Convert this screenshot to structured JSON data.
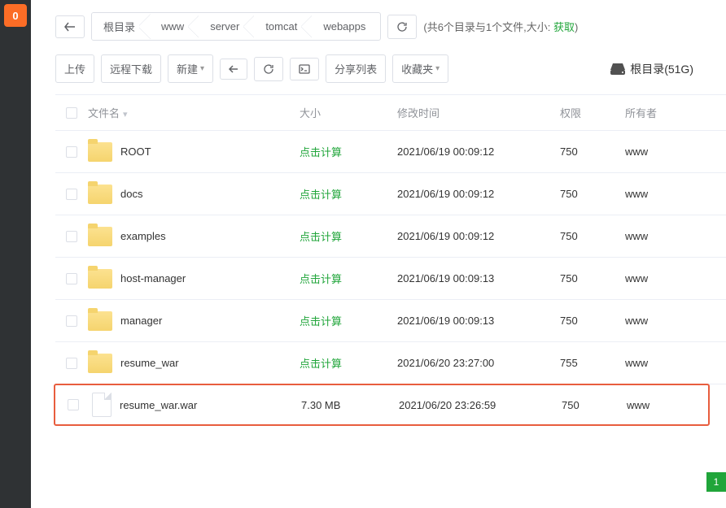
{
  "logo": "0",
  "breadcrumb": [
    "根目录",
    "www",
    "server",
    "tomcat",
    "webapps"
  ],
  "info": {
    "prefix": "(共6个目录与1个文件,大小: ",
    "link": "获取",
    "suffix": ")"
  },
  "toolbar": {
    "upload": "上传",
    "remote": "远程下载",
    "create": "新建",
    "share": "分享列表",
    "favorites": "收藏夹"
  },
  "disk": {
    "label": "根目录(51G)"
  },
  "columns": {
    "name": "文件名",
    "size": "大小",
    "time": "修改时间",
    "perm": "权限",
    "owner": "所有者"
  },
  "calc_label": "点击计算",
  "rows": [
    {
      "type": "folder",
      "name": "ROOT",
      "size": null,
      "time": "2021/06/19 00:09:12",
      "perm": "750",
      "owner": "www"
    },
    {
      "type": "folder",
      "name": "docs",
      "size": null,
      "time": "2021/06/19 00:09:12",
      "perm": "750",
      "owner": "www"
    },
    {
      "type": "folder",
      "name": "examples",
      "size": null,
      "time": "2021/06/19 00:09:12",
      "perm": "750",
      "owner": "www"
    },
    {
      "type": "folder",
      "name": "host-manager",
      "size": null,
      "time": "2021/06/19 00:09:13",
      "perm": "750",
      "owner": "www"
    },
    {
      "type": "folder",
      "name": "manager",
      "size": null,
      "time": "2021/06/19 00:09:13",
      "perm": "750",
      "owner": "www"
    },
    {
      "type": "folder",
      "name": "resume_war",
      "size": null,
      "time": "2021/06/20 23:27:00",
      "perm": "755",
      "owner": "www"
    },
    {
      "type": "file",
      "name": "resume_war.war",
      "size": "7.30 MB",
      "time": "2021/06/20 23:26:59",
      "perm": "750",
      "owner": "www",
      "highlighted": true
    }
  ],
  "page": "1"
}
